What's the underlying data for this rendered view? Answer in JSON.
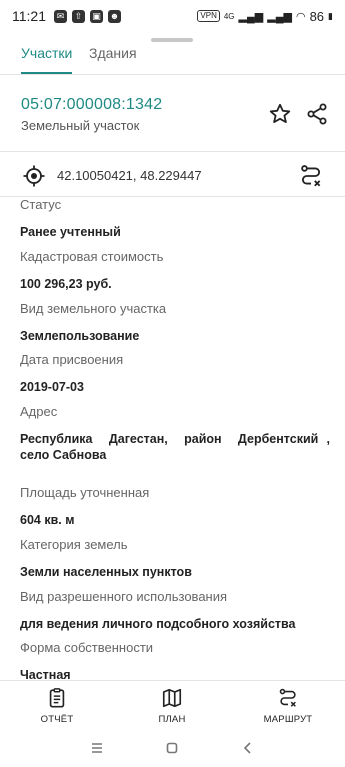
{
  "status_bar": {
    "time": "11:21",
    "vpn": "VPN",
    "network": "4G",
    "battery": "86"
  },
  "tabs": [
    {
      "label": "Участки",
      "active": true
    },
    {
      "label": "Здания",
      "active": false
    }
  ],
  "header": {
    "cadastral_number": "05:07:000008:1342",
    "object_type": "Земельный участок"
  },
  "coordinates": "42.10050421, 48.229447",
  "fields": {
    "status": {
      "label": "Статус",
      "value": "Ранее учтенный"
    },
    "cost": {
      "label": "Кадастровая стоимость",
      "value": "100 296,23 руб."
    },
    "land_type": {
      "label": "Вид земельного участка",
      "value": "Землепользование"
    },
    "date": {
      "label": "Дата присвоения",
      "value": "2019-07-03"
    },
    "address": {
      "label": "Адрес",
      "value": "Республика  Дагестан,  район  Дербентский ,  село Сабнова"
    },
    "area": {
      "label": "Площадь уточненная",
      "value": "604 кв. м"
    },
    "category": {
      "label": "Категория земель",
      "value": "Земли населенных пунктов"
    },
    "permitted_use": {
      "label": "Вид разрешенного использования",
      "value": "для ведения личного подсобного хозяйства"
    },
    "ownership": {
      "label": "Форма собственности",
      "value": "Частная"
    }
  },
  "actions": {
    "report": "ОТЧЁТ",
    "plan": "ПЛАН",
    "route": "МАРШРУТ"
  },
  "colors": {
    "accent": "#1f8a84"
  },
  "icons": [
    "star-icon",
    "share-icon",
    "target-icon",
    "route-icon",
    "report-icon",
    "map-icon",
    "menu-icon",
    "home-icon",
    "back-icon"
  ]
}
